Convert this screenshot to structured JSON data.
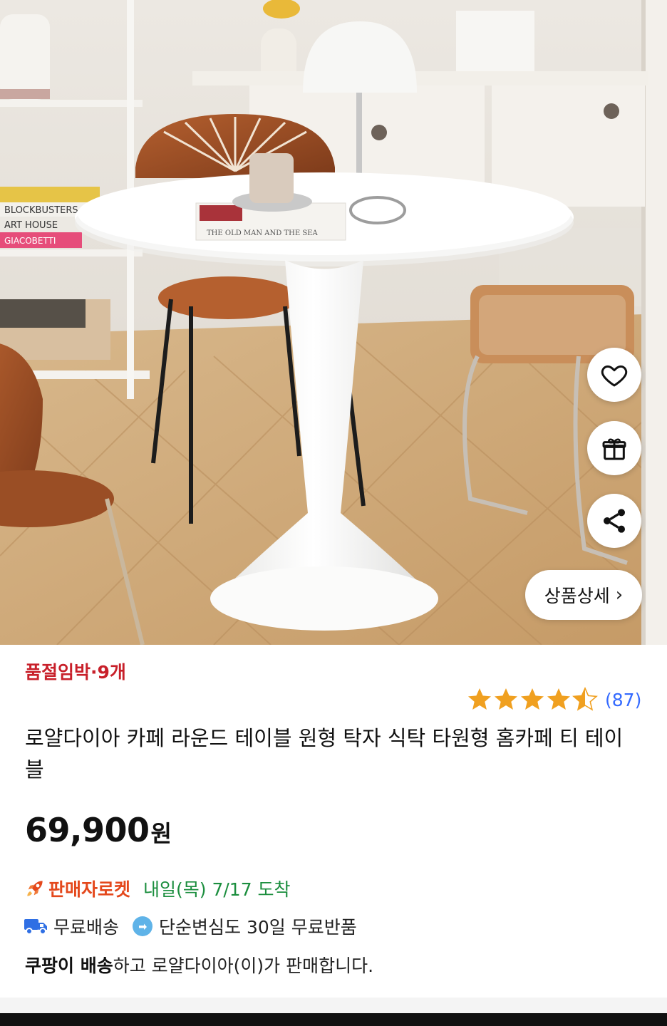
{
  "product_image": {
    "book_text": "THE OLD MAN AND THE SEA",
    "spine_texts": [
      "BLOCKBUSTERS",
      "ART HOUSE",
      "GIACOBETTI"
    ],
    "actions": {
      "like_icon": "heart-icon",
      "gift_icon": "gift-icon",
      "share_icon": "share-icon",
      "detail_label": "상품상세",
      "detail_chevron": "›"
    }
  },
  "product": {
    "stock_alert": "품절임박·9개",
    "rating": {
      "stars": 4.5,
      "max": 5,
      "count_label": "(87)",
      "star_color": "#f0a020"
    },
    "title": "로얄다이아 카페 라운드 테이블 원형 탁자 식탁 타원형 홈카페 티 테이블",
    "price": {
      "amount": "69,900",
      "unit": "원"
    },
    "delivery": {
      "badge_label": "판매자로켓",
      "arrival": "내일(목) 7/17 도착",
      "free_shipping": "무료배송",
      "free_return": "단순변심도 30일 무료반품"
    },
    "seller_line": {
      "bold": "쿠팡이 배송",
      "rest": "하고 로얄다이아(이)가 판매합니다."
    }
  },
  "colors": {
    "stock_red": "#c8202a",
    "rating_blue": "#346aff",
    "arrival_green": "#1b8e3e",
    "rocket_orange": "#e4481c",
    "truck_blue": "#2f6fe4"
  }
}
